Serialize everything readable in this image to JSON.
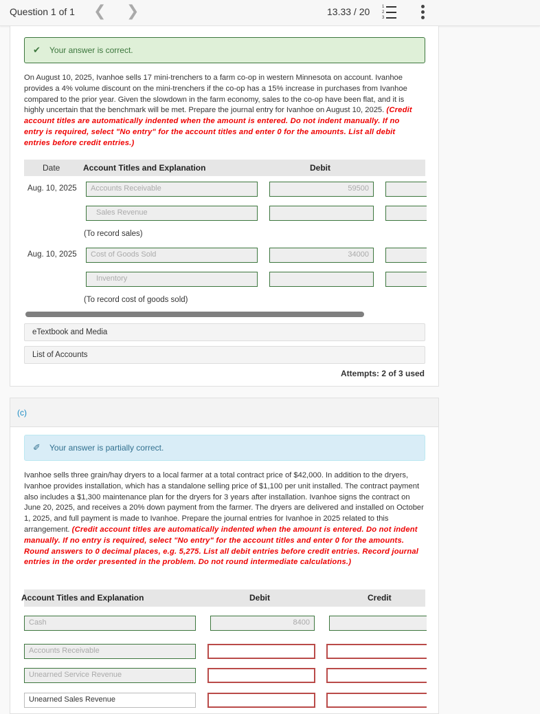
{
  "topbar": {
    "question_label": "Question 1 of 1",
    "prev_icon": "chevron-left-icon",
    "next_icon": "chevron-right-icon",
    "prev_glyph": "❮",
    "next_glyph": "❯",
    "score": "13.33 / 20",
    "list_icon": "numbered-list-icon",
    "list_numbers": [
      "1",
      "2",
      "3"
    ],
    "more_icon": "kebab-menu-icon"
  },
  "part_b": {
    "alert": {
      "icon": "check-icon",
      "glyph": "✔",
      "text": "Your answer is correct.",
      "color": "#3c763d"
    },
    "prompt": "On August 10, 2025, Ivanhoe sells 17 mini-trenchers to a farm co-op in western Minnesota on account. Ivanhoe provides a 4% volume discount on the mini-trenchers if the co-op has a 15% increase in purchases from Ivanhoe compared to the prior year. Given the slowdown in the farm economy, sales to the co-op have been flat, and it is highly uncertain that the benchmark will be met. Prepare the journal entry for Ivanhoe on August 10, 2025.",
    "instructions": "(Credit account titles are automatically indented when the amount is entered. Do not indent manually. If no entry is required, select \"No entry\" for the account titles and enter 0 for the amounts. List all debit entries before credit entries.)",
    "table": {
      "headers": {
        "date": "Date",
        "account": "Account Titles and Explanation",
        "debit": "Debit"
      },
      "entries": [
        {
          "date": "Aug. 10, 2025",
          "lines": [
            {
              "account": "Accounts Receivable",
              "debit": "59500",
              "credit": ""
            },
            {
              "account": "Sales Revenue",
              "debit": "",
              "credit": ""
            }
          ],
          "explanation": "(To record sales)"
        },
        {
          "date": "Aug. 10, 2025",
          "lines": [
            {
              "account": "Cost of Goods Sold",
              "debit": "34000",
              "credit": ""
            },
            {
              "account": "Inventory",
              "debit": "",
              "credit": ""
            }
          ],
          "explanation": "(To record cost of goods sold)"
        }
      ]
    },
    "resources": [
      "eTextbook and Media",
      "List of Accounts"
    ],
    "attempts": "Attempts: 2 of 3 used"
  },
  "part_c": {
    "label": "(c)",
    "alert": {
      "icon": "eraser-icon",
      "glyph": "✐",
      "text": "Your answer is partially correct.",
      "color": "#31708f"
    },
    "prompt": "Ivanhoe sells three grain/hay dryers to a local farmer at a total contract price of $42,000. In addition to the dryers, Ivanhoe provides installation, which has a standalone selling price of $1,100 per unit installed. The contract payment also includes a $1,300 maintenance plan for the dryers for 3 years after installation. Ivanhoe signs the contract on June 20, 2025, and receives a 20% down payment from the farmer. The dryers are delivered and installed on October 1, 2025, and full payment is made to Ivanhoe. Prepare the journal entries for Ivanhoe in 2025 related to this arrangement.",
    "instructions": "(Credit account titles are automatically indented when the amount is entered. Do not indent manually. If no entry is required, select \"No entry\" for the account titles and enter 0 for the amounts. Round answers to 0 decimal places, e.g. 5,275. List all debit entries before credit entries. Record journal entries in the order presented in the problem. Do not round intermediate calculations.)",
    "table": {
      "headers": {
        "account": "Account Titles and Explanation",
        "debit": "Debit",
        "credit": "Credit"
      },
      "lines": [
        {
          "account": "Cash",
          "debit": "8400",
          "credit": ""
        },
        {
          "account": "Accounts Receivable",
          "debit": "",
          "credit": ""
        },
        {
          "account": "Unearned Service Revenue",
          "debit": "",
          "credit": ""
        },
        {
          "account": "Unearned Sales Revenue",
          "debit": "",
          "credit": ""
        }
      ]
    }
  }
}
